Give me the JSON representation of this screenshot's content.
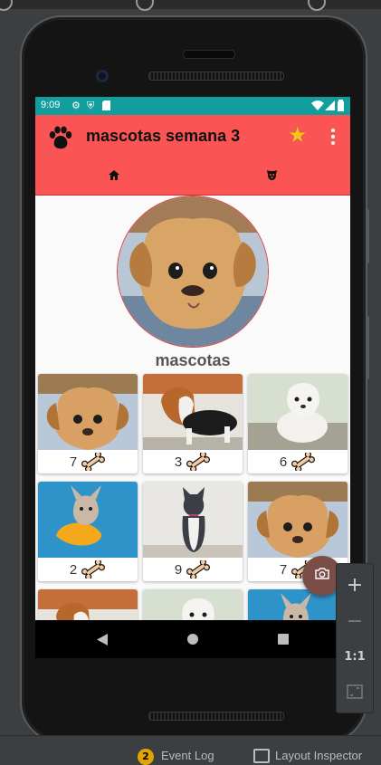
{
  "status_bar": {
    "time": "9:09",
    "icons": [
      "gear-icon",
      "shield-icon",
      "sim-card-icon"
    ],
    "right_icons": [
      "wifi-icon",
      "cell-signal-icon",
      "battery-icon"
    ]
  },
  "toolbar": {
    "logo_icon": "paw-icon",
    "title": "mascotas semana 3",
    "star_icon": "star-icon",
    "more_icon": "more-vert-icon"
  },
  "tabs": [
    {
      "icon": "home-icon"
    },
    {
      "icon": "dog-face-icon"
    }
  ],
  "profile": {
    "name": "mascotas"
  },
  "pets": [
    {
      "likes": "7",
      "photo": "puppy-chihuahua"
    },
    {
      "likes": "3",
      "photo": "puppy-beagle"
    },
    {
      "likes": "6",
      "photo": "puppy-labrador"
    },
    {
      "likes": "2",
      "photo": "french-bulldog"
    },
    {
      "likes": "9",
      "photo": "cat-tuxedo"
    },
    {
      "likes": "7",
      "photo": "puppy-chihuahua"
    },
    {
      "likes": "",
      "photo": "puppy-beagle"
    },
    {
      "likes": "",
      "photo": "puppy-labrador"
    },
    {
      "likes": "",
      "photo": "french-bulldog"
    }
  ],
  "fab_icon": "camera-icon",
  "nav": [
    "back-icon",
    "home-circle-icon",
    "recents-icon"
  ],
  "emulator_panel": {
    "zoom_in": "+",
    "zoom_out": "−",
    "actual_size": "1:1",
    "fit_icon": "fit-screen-icon"
  },
  "ide_bottom": {
    "event_log_count": "2",
    "event_log_label": "Event Log",
    "layout_inspector_label": "Layout Inspector"
  },
  "colors": {
    "toolbar": "#fa5454",
    "status_bar": "#129e9d",
    "fab": "#7a4d46",
    "star": "#f7c21c"
  }
}
